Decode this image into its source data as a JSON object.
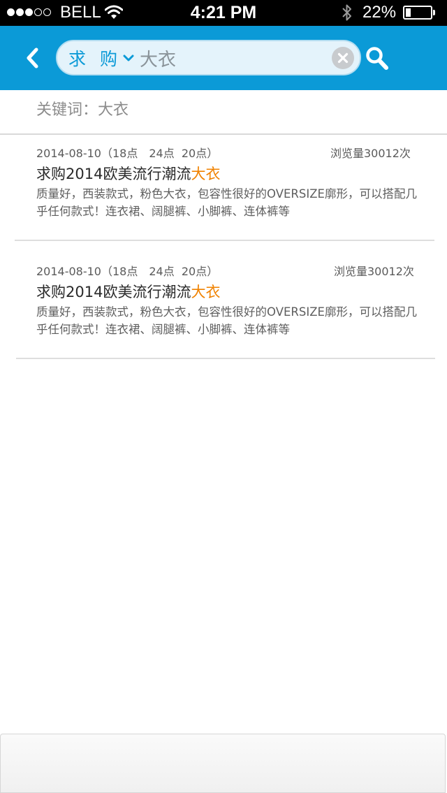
{
  "status_bar": {
    "signal_total": 5,
    "signal_filled": 3,
    "carrier": "BELL",
    "wifi_icon": "wifi-icon",
    "time": "4:21 PM",
    "bluetooth_icon": "bluetooth-icon",
    "battery_text": "22%",
    "battery_level": 0.22
  },
  "nav": {
    "back_icon": "chevron-left-icon",
    "search": {
      "category": "求 购",
      "category_icon": "chevron-down-icon",
      "query": "大衣",
      "clear_icon": "clear-icon"
    },
    "search_icon": "search-icon"
  },
  "keyword": {
    "text": "关键词：大衣"
  },
  "results": [
    {
      "meta": "2014-08-10（18点　24点  20点）",
      "views": "浏览量30012次",
      "title_prefix": "求购2014欧美流行潮流",
      "title_highlight": "大衣",
      "desc": "质量好，西装款式，粉色大衣，包容性很好的OVERSIZE廓形，可以搭配几乎任何款式！连衣裙、阔腿裤、小脚裤、连体裤等"
    },
    {
      "meta": "2014-08-10（18点　24点  20点）",
      "views": "浏览量30012次",
      "title_prefix": "求购2014欧美流行潮流",
      "title_highlight": "大衣",
      "desc": "质量好，西装款式，粉色大衣，包容性很好的OVERSIZE廓形，可以搭配几乎任何款式！连衣裙、阔腿裤、小脚裤、连体裤等"
    }
  ],
  "colors": {
    "nav_background": "#0b9ad7",
    "highlight": "#f08200",
    "search_box": "#e4f3fb"
  }
}
